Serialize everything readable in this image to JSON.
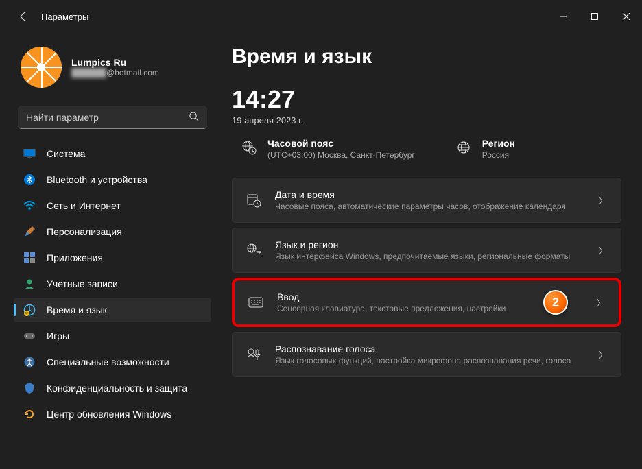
{
  "window": {
    "title": "Параметры"
  },
  "profile": {
    "name": "Lumpics Ru",
    "email_masked": "██████",
    "email_domain": "@hotmail.com"
  },
  "search": {
    "placeholder": "Найти параметр"
  },
  "sidebar": {
    "items": [
      {
        "label": "Система",
        "icon": "system-icon"
      },
      {
        "label": "Bluetooth и устройства",
        "icon": "bluetooth-icon"
      },
      {
        "label": "Сеть и Интернет",
        "icon": "wifi-icon"
      },
      {
        "label": "Персонализация",
        "icon": "personalization-icon"
      },
      {
        "label": "Приложения",
        "icon": "apps-icon"
      },
      {
        "label": "Учетные записи",
        "icon": "accounts-icon"
      },
      {
        "label": "Время и язык",
        "icon": "time-language-icon",
        "active": true
      },
      {
        "label": "Игры",
        "icon": "gaming-icon"
      },
      {
        "label": "Специальные возможности",
        "icon": "accessibility-icon"
      },
      {
        "label": "Конфиденциальность и защита",
        "icon": "privacy-icon"
      },
      {
        "label": "Центр обновления Windows",
        "icon": "update-icon"
      }
    ]
  },
  "main": {
    "title": "Время и язык",
    "time": "14:27",
    "date": "19 апреля 2023 г.",
    "info": {
      "timezone": {
        "title": "Часовой пояс",
        "desc": "(UTC+03:00) Москва, Санкт-Петербург"
      },
      "region": {
        "title": "Регион",
        "desc": "Россия"
      }
    },
    "settings": [
      {
        "title": "Дата и время",
        "desc": "Часовые пояса, автоматические параметры часов, отображение календаря"
      },
      {
        "title": "Язык и регион",
        "desc": "Язык интерфейса Windows, предпочитаемые языки, региональные форматы"
      },
      {
        "title": "Ввод",
        "desc": "Сенсорная клавиатура, текстовые предложения, настройки",
        "highlighted": true,
        "badge": "2"
      },
      {
        "title": "Распознавание голоса",
        "desc": "Язык голосовых функций, настройка микрофона распознавания речи, голоса"
      }
    ]
  }
}
